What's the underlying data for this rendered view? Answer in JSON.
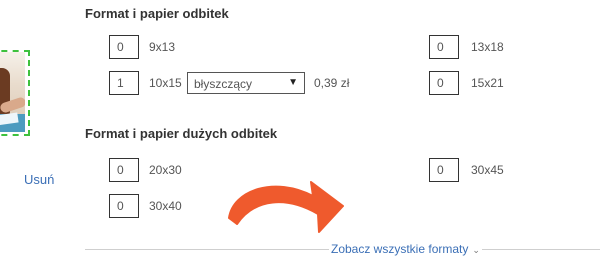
{
  "photo": {
    "remove_label": "Usuń"
  },
  "sections": [
    {
      "title": "Format i papier odbitek",
      "rows": [
        {
          "qty": "0",
          "size": "9x13"
        },
        {
          "qty": "1",
          "size": "10x15",
          "paper": "błyszczący",
          "price": "0,39 zł"
        },
        {
          "qty": "0",
          "size": "13x18"
        },
        {
          "qty": "0",
          "size": "15x21"
        }
      ]
    },
    {
      "title": "Format i papier dużych odbitek",
      "rows": [
        {
          "qty": "0",
          "size": "20x30"
        },
        {
          "qty": "0",
          "size": "30x45"
        },
        {
          "qty": "0",
          "size": "30x40"
        }
      ]
    }
  ],
  "see_all_label": "Zobacz wszystkie formaty",
  "icons": {
    "dropdown": "caret-down-icon",
    "see_all": "chevron-down-icon",
    "arrow": "curved-arrow-icon"
  },
  "colors": {
    "link": "#3b6fb6",
    "selection_border": "#3ec13e",
    "arrow": "#ef5a2d"
  }
}
